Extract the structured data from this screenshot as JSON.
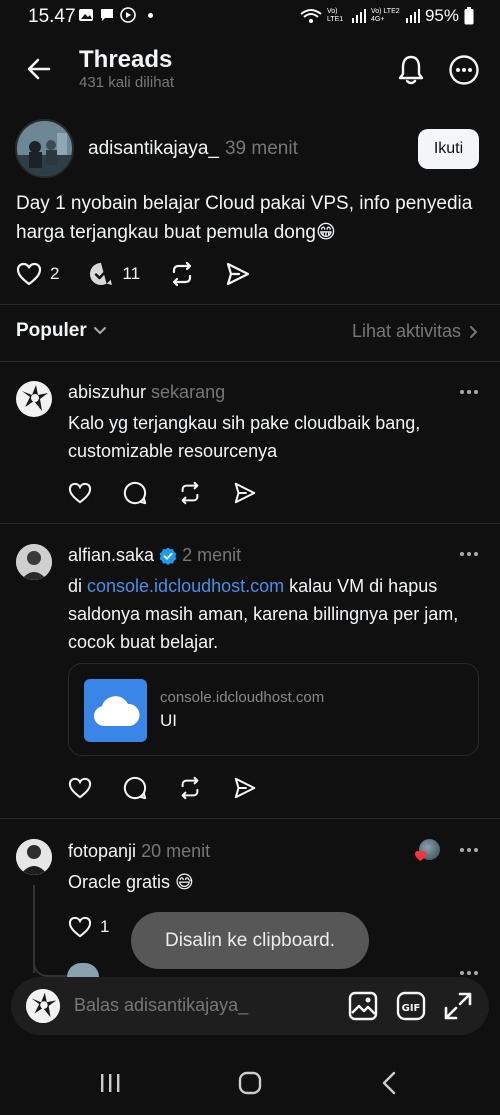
{
  "status_bar": {
    "time": "15.47",
    "battery": "95%",
    "sim1": "Vo) LTE1",
    "sim2": "Vo) LTE2 4G+"
  },
  "header": {
    "title": "Threads",
    "subtitle": "431 kali dilihat"
  },
  "post": {
    "username": "adisantikajaya_",
    "time": "39 menit",
    "follow_label": "Ikuti",
    "text": "Day 1 nyobain belajar Cloud pakai VPS, info penyedia harga terjangkau buat pemula dong😁",
    "likes": "2",
    "replies": "11"
  },
  "sort": {
    "label": "Populer",
    "activity_label": "Lihat aktivitas"
  },
  "replies": [
    {
      "username": "abiszuhur",
      "time": "sekarang",
      "text": "Kalo yg terjangkau sih pake cloudbaik bang, customizable resourcenya"
    },
    {
      "username": "alfian.saka",
      "verified": true,
      "time": "2 menit",
      "text_prefix": "di ",
      "link": "console.idcloudhost.com",
      "text_suffix": " kalau VM di hapus saldonya masih aman, karena billingnya per jam, cocok buat belajar.",
      "card": {
        "domain": "console.idcloudhost.com",
        "title": "UI"
      }
    },
    {
      "username": "fotopanji",
      "time": "20 menit",
      "text": "Oracle gratis 😅",
      "likes": "1"
    }
  ],
  "toast": "Disalin ke clipboard.",
  "reply_bar": {
    "placeholder": "Balas adisantikajaya_"
  },
  "colors": {
    "background": "#101010",
    "text": "#f3f5f7",
    "muted": "#777777",
    "link": "#4a8fe8",
    "verified": "#1d9bf0"
  }
}
